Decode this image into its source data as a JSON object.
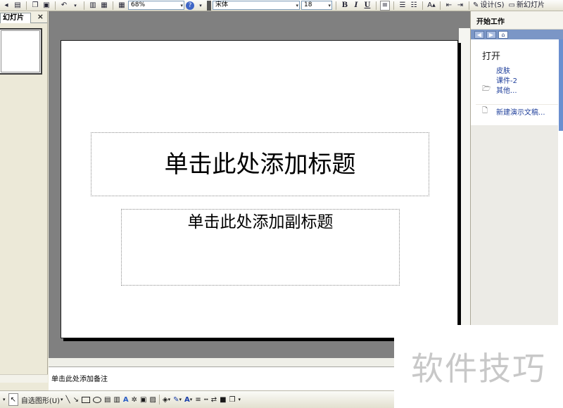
{
  "toolbar": {
    "zoom_value": "68%",
    "font_name": "宋体",
    "font_size": "18",
    "bold_label": "B",
    "italic_label": "I",
    "underline_label": "U",
    "design_label": "设计(S)",
    "new_slide_label": "新幻灯片"
  },
  "left_pane": {
    "tab_label": "幻灯片",
    "close_glyph": "×"
  },
  "slide": {
    "title_placeholder": "单击此处添加标题",
    "subtitle_placeholder": "单击此处添加副标题"
  },
  "notes": {
    "placeholder": "单击此处添加备注"
  },
  "drawing_toolbar": {
    "autoshapes_label": "自选图形(U)"
  },
  "task_pane": {
    "header": "开始工作",
    "open_title": "打开",
    "links": [
      "皮肤",
      "课件-2",
      "其他..."
    ],
    "new_presentation": "新建演示文稿..."
  },
  "watermark": {
    "text": "软件技巧"
  },
  "colors": {
    "canvas_bg": "#808080",
    "link_blue": "#1f3f9b",
    "task_nav_blue": "#7b96c6"
  }
}
